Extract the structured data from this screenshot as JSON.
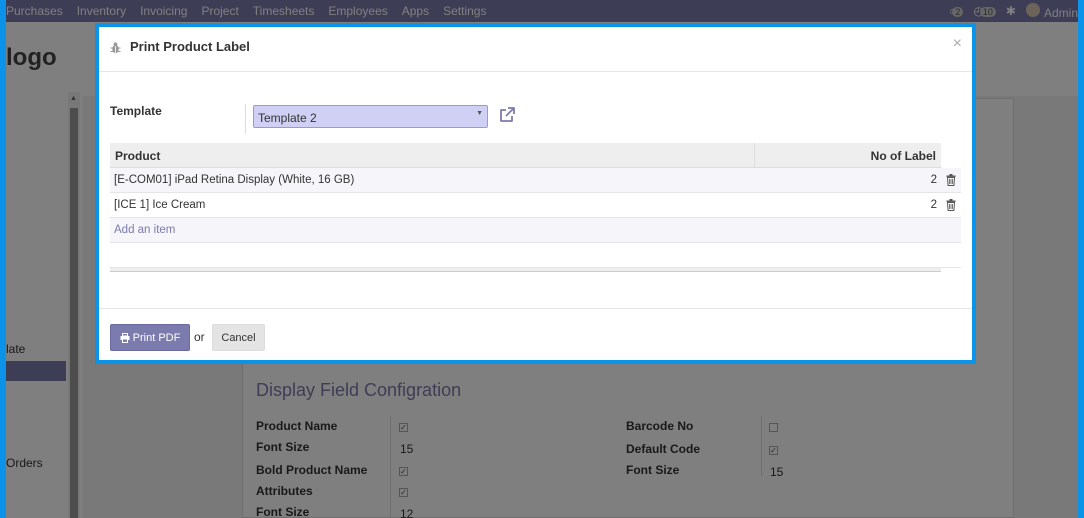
{
  "app": {
    "menu": [
      "Purchases",
      "Inventory",
      "Invoicing",
      "Project",
      "Timesheets",
      "Employees",
      "Apps",
      "Settings"
    ],
    "badges": [
      "2",
      "10"
    ],
    "user": "Admin",
    "logo": "logo",
    "sidebar_items": [
      "late",
      "Orders"
    ]
  },
  "background_form": {
    "section_title": "Display Field Configration",
    "left_fields": [
      {
        "label": "Product Name",
        "value": "✓"
      },
      {
        "label": "Font Size",
        "value": "15"
      },
      {
        "label": "Bold Product Name",
        "value": "✓"
      },
      {
        "label": "Attributes",
        "value": "✓"
      },
      {
        "label": "Font Size",
        "value": "12"
      }
    ],
    "right_fields": [
      {
        "label": "Barcode No",
        "value": ""
      },
      {
        "label": "Default Code",
        "value": "✓"
      },
      {
        "label": "Font Size",
        "value": "15"
      }
    ]
  },
  "modal": {
    "title": "Print Product Label",
    "close": "×",
    "template_label": "Template",
    "template_value": "Template 2",
    "table": {
      "headers": {
        "product": "Product",
        "qty": "No of Label"
      },
      "rows": [
        {
          "product": "[E-COM01] iPad Retina Display (White, 16 GB)",
          "qty": "2"
        },
        {
          "product": "[ICE 1] Ice Cream",
          "qty": "2"
        }
      ],
      "add_item": "Add an item"
    },
    "footer": {
      "print": "Print PDF",
      "or": "or",
      "cancel": "Cancel"
    }
  },
  "colors": {
    "accent": "#7c7bad",
    "frame": "#0a93e8",
    "select_bg": "#d0d0f5"
  }
}
